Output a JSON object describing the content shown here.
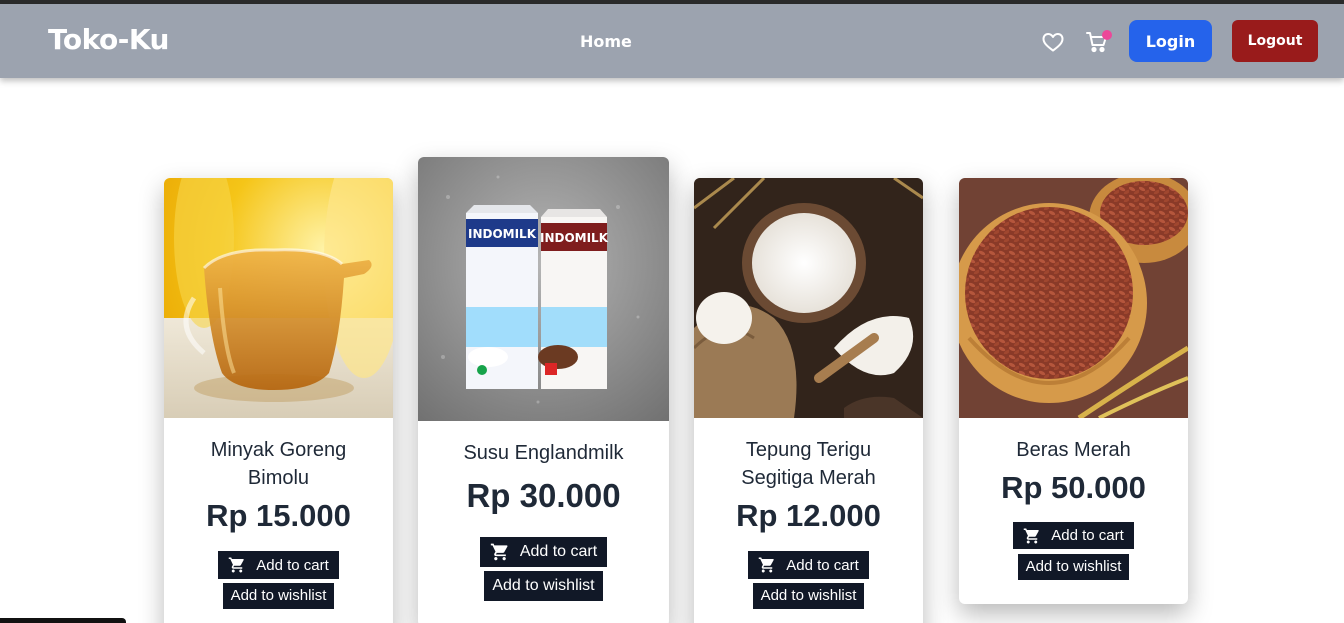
{
  "navbar": {
    "brand": "Toko-Ku",
    "home": "Home",
    "login": "Login",
    "logout": "Logout",
    "wishlist_icon": "heart-icon",
    "cart_icon": "cart-icon"
  },
  "products": [
    {
      "name": "Minyak Goreng Bimolu",
      "price": "Rp 15.000",
      "cart": "Add to cart",
      "wishlist": "Add to wishlist"
    },
    {
      "name": "Susu Englandmilk",
      "price": "Rp 30.000",
      "cart": "Add to cart",
      "wishlist": "Add to wishlist"
    },
    {
      "name": "Tepung Terigu Segitiga Merah",
      "price": "Rp 12.000",
      "cart": "Add to cart",
      "wishlist": "Add to wishlist"
    },
    {
      "name": "Beras Merah",
      "price": "Rp 50.000",
      "cart": "Add to cart",
      "wishlist": "Add to wishlist"
    }
  ],
  "product_images": [
    {
      "label": "INDOMILK"
    },
    {
      "label": "INDOMILK"
    }
  ],
  "colors": {
    "navbar": "#9ca3af",
    "login": "#2563eb",
    "logout": "#991b1b",
    "button_dark": "#111827",
    "badge": "#ec4899"
  }
}
